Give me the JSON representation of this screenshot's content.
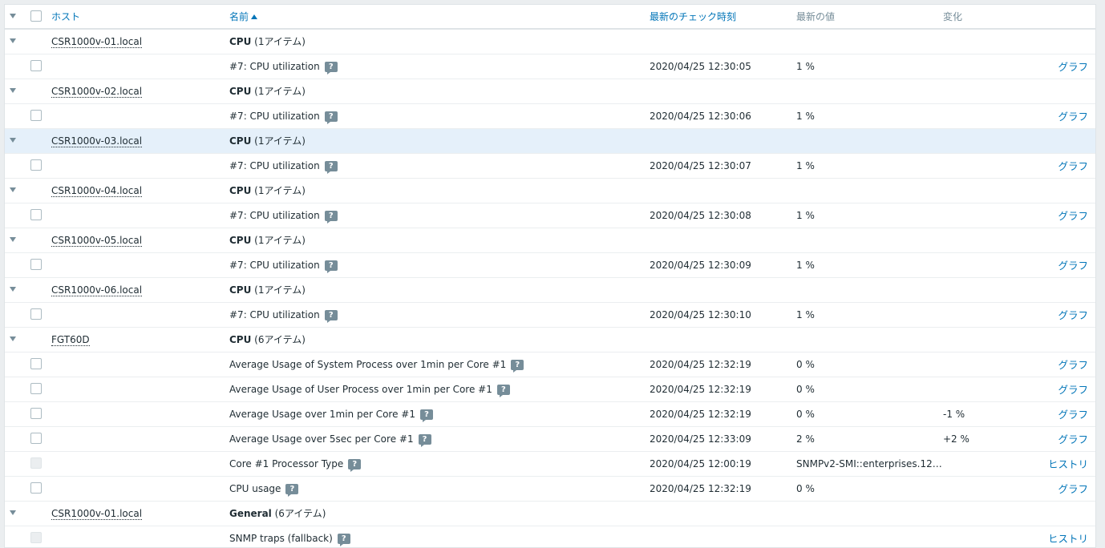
{
  "header": {
    "host": "ホスト",
    "name": "名前",
    "last_check": "最新のチェック時刻",
    "last_value": "最新の値",
    "change": "変化"
  },
  "rows": [
    {
      "type": "group",
      "host": "CSR1000v-01.local",
      "app": "CPU",
      "count": " (1アイテム)"
    },
    {
      "type": "item",
      "name": "#7: CPU utilization",
      "time": "2020/04/25 12:30:05",
      "value": "1 %",
      "change": "",
      "action": "グラフ"
    },
    {
      "type": "group",
      "host": "CSR1000v-02.local",
      "app": "CPU",
      "count": " (1アイテム)"
    },
    {
      "type": "item",
      "name": "#7: CPU utilization",
      "time": "2020/04/25 12:30:06",
      "value": "1 %",
      "change": "",
      "action": "グラフ"
    },
    {
      "type": "group",
      "host": "CSR1000v-03.local",
      "app": "CPU",
      "count": " (1アイテム)",
      "highlight": true
    },
    {
      "type": "item",
      "name": "#7: CPU utilization",
      "time": "2020/04/25 12:30:07",
      "value": "1 %",
      "change": "",
      "action": "グラフ"
    },
    {
      "type": "group",
      "host": "CSR1000v-04.local",
      "app": "CPU",
      "count": " (1アイテム)"
    },
    {
      "type": "item",
      "name": "#7: CPU utilization",
      "time": "2020/04/25 12:30:08",
      "value": "1 %",
      "change": "",
      "action": "グラフ"
    },
    {
      "type": "group",
      "host": "CSR1000v-05.local",
      "app": "CPU",
      "count": " (1アイテム)"
    },
    {
      "type": "item",
      "name": "#7: CPU utilization",
      "time": "2020/04/25 12:30:09",
      "value": "1 %",
      "change": "",
      "action": "グラフ"
    },
    {
      "type": "group",
      "host": "CSR1000v-06.local",
      "app": "CPU",
      "count": " (1アイテム)"
    },
    {
      "type": "item",
      "name": "#7: CPU utilization",
      "time": "2020/04/25 12:30:10",
      "value": "1 %",
      "change": "",
      "action": "グラフ"
    },
    {
      "type": "group",
      "host": "FGT60D",
      "app": "CPU",
      "count": " (6アイテム)"
    },
    {
      "type": "item",
      "name": "Average Usage of System Process over 1min per Core #1",
      "time": "2020/04/25 12:32:19",
      "value": "0 %",
      "change": "",
      "action": "グラフ"
    },
    {
      "type": "item",
      "name": "Average Usage of User Process over 1min per Core #1",
      "time": "2020/04/25 12:32:19",
      "value": "0 %",
      "change": "",
      "action": "グラフ"
    },
    {
      "type": "item",
      "name": "Average Usage over 1min per Core #1",
      "time": "2020/04/25 12:32:19",
      "value": "0 %",
      "change": "-1 %",
      "action": "グラフ"
    },
    {
      "type": "item",
      "name": "Average Usage over 5sec per Core #1",
      "time": "2020/04/25 12:33:09",
      "value": "2 %",
      "change": "+2 %",
      "action": "グラフ"
    },
    {
      "type": "item",
      "name": "Core #1 Processor Type",
      "time": "2020/04/25 12:00:19",
      "value": "SNMPv2-SMI::enterprises.12…",
      "change": "",
      "action": "ヒストリ",
      "disabled": true
    },
    {
      "type": "item",
      "name": "CPU usage",
      "time": "2020/04/25 12:32:19",
      "value": "0 %",
      "change": "",
      "action": "グラフ"
    },
    {
      "type": "group",
      "host": "CSR1000v-01.local",
      "app": "General",
      "count": " (6アイテム)"
    },
    {
      "type": "item",
      "name": "SNMP traps (fallback)",
      "time": "",
      "value": "",
      "change": "",
      "action": "ヒストリ",
      "disabled": true
    }
  ]
}
